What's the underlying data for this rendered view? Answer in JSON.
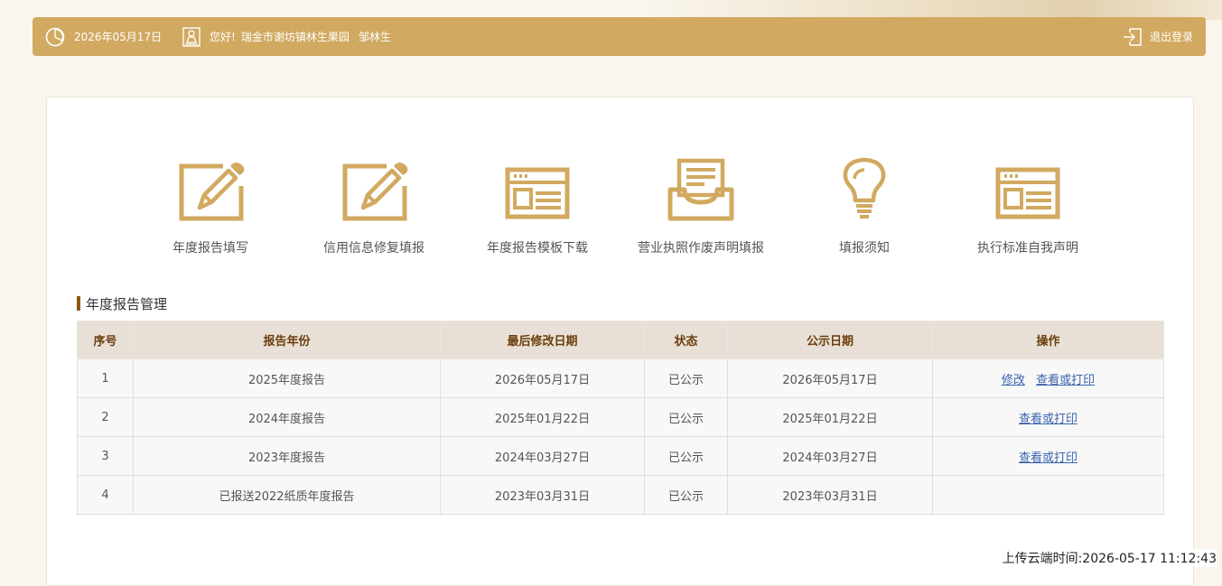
{
  "header": {
    "date": "2026年05月17日",
    "greeting": "您好!",
    "company": "瑞金市谢坊镇林生果园",
    "user": "邹林生",
    "logout_label": "退出登录",
    "accent_color": "#d1a960"
  },
  "menu": [
    {
      "label": "年度报告填写",
      "icon": "edit-pencil-icon"
    },
    {
      "label": "信用信息修复填报",
      "icon": "edit-pencil-icon"
    },
    {
      "label": "年度报告模板下载",
      "icon": "document-template-icon"
    },
    {
      "label": "营业执照作废声明填报",
      "icon": "inbox-tray-icon"
    },
    {
      "label": "填报须知",
      "icon": "lightbulb-icon"
    },
    {
      "label": "执行标准自我声明",
      "icon": "document-template-icon"
    }
  ],
  "section": {
    "title": "年度报告管理"
  },
  "table": {
    "headers": [
      "序号",
      "报告年份",
      "最后修改日期",
      "状态",
      "公示日期",
      "操作"
    ],
    "rows": [
      {
        "no": "1",
        "year": "2025年度报告",
        "modified": "2026年05月17日",
        "status": "已公示",
        "publish": "2026年05月17日",
        "actions": [
          "修改",
          "查看或打印"
        ]
      },
      {
        "no": "2",
        "year": "2024年度报告",
        "modified": "2025年01月22日",
        "status": "已公示",
        "publish": "2025年01月22日",
        "actions": [
          "查看或打印"
        ]
      },
      {
        "no": "3",
        "year": "2023年度报告",
        "modified": "2024年03月27日",
        "status": "已公示",
        "publish": "2024年03月27日",
        "actions": [
          "查看或打印"
        ]
      },
      {
        "no": "4",
        "year": "已报送2022纸质年度报告",
        "modified": "2023年03月31日",
        "status": "已公示",
        "publish": "2023年03月31日",
        "actions": []
      }
    ]
  },
  "footer": {
    "upload_time": "上传云端时间:2026-05-17 11:12:43"
  }
}
